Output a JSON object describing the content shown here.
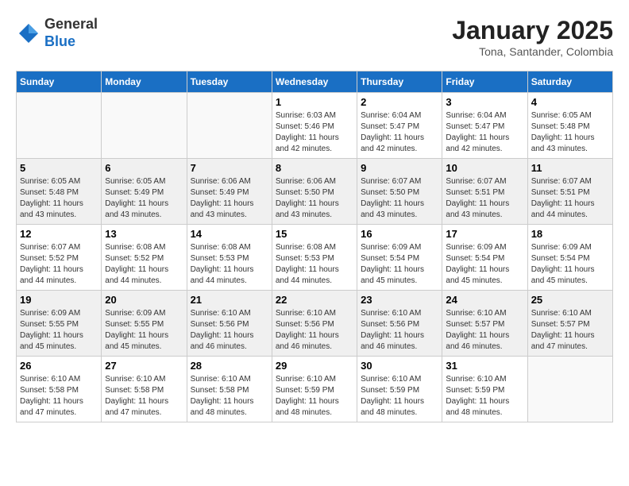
{
  "header": {
    "logo_general": "General",
    "logo_blue": "Blue",
    "month_title": "January 2025",
    "location": "Tona, Santander, Colombia"
  },
  "days_of_week": [
    "Sunday",
    "Monday",
    "Tuesday",
    "Wednesday",
    "Thursday",
    "Friday",
    "Saturday"
  ],
  "weeks": [
    {
      "shaded": false,
      "days": [
        {
          "num": "",
          "info": ""
        },
        {
          "num": "",
          "info": ""
        },
        {
          "num": "",
          "info": ""
        },
        {
          "num": "1",
          "info": "Sunrise: 6:03 AM\nSunset: 5:46 PM\nDaylight: 11 hours\nand 42 minutes."
        },
        {
          "num": "2",
          "info": "Sunrise: 6:04 AM\nSunset: 5:47 PM\nDaylight: 11 hours\nand 42 minutes."
        },
        {
          "num": "3",
          "info": "Sunrise: 6:04 AM\nSunset: 5:47 PM\nDaylight: 11 hours\nand 42 minutes."
        },
        {
          "num": "4",
          "info": "Sunrise: 6:05 AM\nSunset: 5:48 PM\nDaylight: 11 hours\nand 43 minutes."
        }
      ]
    },
    {
      "shaded": true,
      "days": [
        {
          "num": "5",
          "info": "Sunrise: 6:05 AM\nSunset: 5:48 PM\nDaylight: 11 hours\nand 43 minutes."
        },
        {
          "num": "6",
          "info": "Sunrise: 6:05 AM\nSunset: 5:49 PM\nDaylight: 11 hours\nand 43 minutes."
        },
        {
          "num": "7",
          "info": "Sunrise: 6:06 AM\nSunset: 5:49 PM\nDaylight: 11 hours\nand 43 minutes."
        },
        {
          "num": "8",
          "info": "Sunrise: 6:06 AM\nSunset: 5:50 PM\nDaylight: 11 hours\nand 43 minutes."
        },
        {
          "num": "9",
          "info": "Sunrise: 6:07 AM\nSunset: 5:50 PM\nDaylight: 11 hours\nand 43 minutes."
        },
        {
          "num": "10",
          "info": "Sunrise: 6:07 AM\nSunset: 5:51 PM\nDaylight: 11 hours\nand 43 minutes."
        },
        {
          "num": "11",
          "info": "Sunrise: 6:07 AM\nSunset: 5:51 PM\nDaylight: 11 hours\nand 44 minutes."
        }
      ]
    },
    {
      "shaded": false,
      "days": [
        {
          "num": "12",
          "info": "Sunrise: 6:07 AM\nSunset: 5:52 PM\nDaylight: 11 hours\nand 44 minutes."
        },
        {
          "num": "13",
          "info": "Sunrise: 6:08 AM\nSunset: 5:52 PM\nDaylight: 11 hours\nand 44 minutes."
        },
        {
          "num": "14",
          "info": "Sunrise: 6:08 AM\nSunset: 5:53 PM\nDaylight: 11 hours\nand 44 minutes."
        },
        {
          "num": "15",
          "info": "Sunrise: 6:08 AM\nSunset: 5:53 PM\nDaylight: 11 hours\nand 44 minutes."
        },
        {
          "num": "16",
          "info": "Sunrise: 6:09 AM\nSunset: 5:54 PM\nDaylight: 11 hours\nand 45 minutes."
        },
        {
          "num": "17",
          "info": "Sunrise: 6:09 AM\nSunset: 5:54 PM\nDaylight: 11 hours\nand 45 minutes."
        },
        {
          "num": "18",
          "info": "Sunrise: 6:09 AM\nSunset: 5:54 PM\nDaylight: 11 hours\nand 45 minutes."
        }
      ]
    },
    {
      "shaded": true,
      "days": [
        {
          "num": "19",
          "info": "Sunrise: 6:09 AM\nSunset: 5:55 PM\nDaylight: 11 hours\nand 45 minutes."
        },
        {
          "num": "20",
          "info": "Sunrise: 6:09 AM\nSunset: 5:55 PM\nDaylight: 11 hours\nand 45 minutes."
        },
        {
          "num": "21",
          "info": "Sunrise: 6:10 AM\nSunset: 5:56 PM\nDaylight: 11 hours\nand 46 minutes."
        },
        {
          "num": "22",
          "info": "Sunrise: 6:10 AM\nSunset: 5:56 PM\nDaylight: 11 hours\nand 46 minutes."
        },
        {
          "num": "23",
          "info": "Sunrise: 6:10 AM\nSunset: 5:56 PM\nDaylight: 11 hours\nand 46 minutes."
        },
        {
          "num": "24",
          "info": "Sunrise: 6:10 AM\nSunset: 5:57 PM\nDaylight: 11 hours\nand 46 minutes."
        },
        {
          "num": "25",
          "info": "Sunrise: 6:10 AM\nSunset: 5:57 PM\nDaylight: 11 hours\nand 47 minutes."
        }
      ]
    },
    {
      "shaded": false,
      "days": [
        {
          "num": "26",
          "info": "Sunrise: 6:10 AM\nSunset: 5:58 PM\nDaylight: 11 hours\nand 47 minutes."
        },
        {
          "num": "27",
          "info": "Sunrise: 6:10 AM\nSunset: 5:58 PM\nDaylight: 11 hours\nand 47 minutes."
        },
        {
          "num": "28",
          "info": "Sunrise: 6:10 AM\nSunset: 5:58 PM\nDaylight: 11 hours\nand 48 minutes."
        },
        {
          "num": "29",
          "info": "Sunrise: 6:10 AM\nSunset: 5:59 PM\nDaylight: 11 hours\nand 48 minutes."
        },
        {
          "num": "30",
          "info": "Sunrise: 6:10 AM\nSunset: 5:59 PM\nDaylight: 11 hours\nand 48 minutes."
        },
        {
          "num": "31",
          "info": "Sunrise: 6:10 AM\nSunset: 5:59 PM\nDaylight: 11 hours\nand 48 minutes."
        },
        {
          "num": "",
          "info": ""
        }
      ]
    }
  ]
}
